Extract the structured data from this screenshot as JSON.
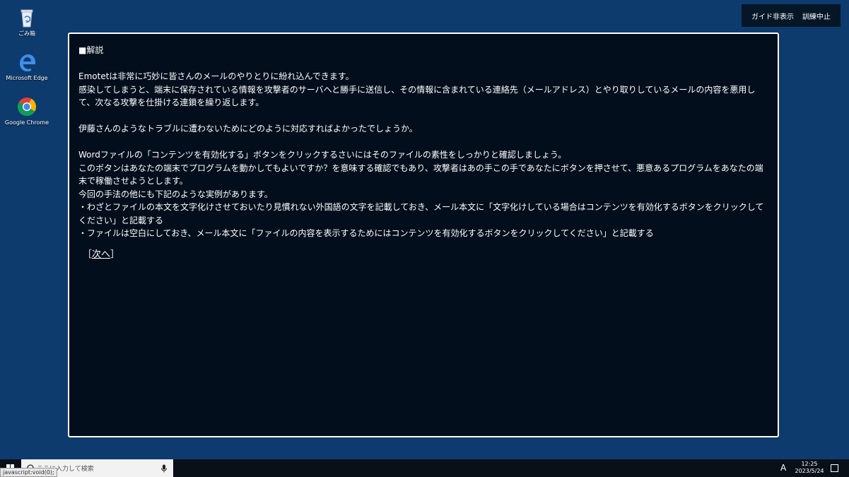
{
  "desktop": {
    "icons": [
      {
        "label": "ごみ箱",
        "icon": "recycle-bin-icon"
      },
      {
        "label": "Microsoft Edge",
        "icon": "edge-icon"
      },
      {
        "label": "Google Chrome",
        "icon": "chrome-icon"
      }
    ]
  },
  "guide_bar": {
    "hide_guide": "ガイド非表示",
    "stop_training": "訓練中止"
  },
  "panel": {
    "heading": "■解説",
    "paragraphs": [
      "Emotetは非常に巧妙に皆さんのメールのやりとりに紛れ込んできます。",
      "感染してしまうと、端末に保存されている情報を攻撃者のサーバへと勝手に送信し、その情報に含まれている連絡先（メールアドレス）とやり取りしているメールの内容を悪用して、次なる攻撃を仕掛ける連鎖を繰り返します。",
      "伊藤さんのようなトラブルに遭わないためにどのように対応すればよかったでしょうか。",
      "Wordファイルの「コンテンツを有効化する」ボタンをクリックするさいにはそのファイルの素性をしっかりと確認しましょう。",
      "このボタンはあなたの端末でプログラムを動かしてもよいですか？を意味する確認でもあり、攻撃者はあの手この手であなたにボタンを押させて、悪意あるプログラムをあなたの端末で稼働させようとします。",
      "今回の手法の他にも下記のような実例があります。",
      "・わざとファイルの本文を文字化けさせておいたり見慣れない外国語の文字を記載しておき、メール本文に「文字化けしている場合はコンテンツを有効化するボタンをクリックしてください」と記載する",
      "・ファイルは空白にしておき、メール本文に「ファイルの内容を表示するためにはコンテンツを有効化するボタンをクリックしてください」と記載する"
    ],
    "next_open": "［",
    "next_link": "次へ",
    "next_close": "］"
  },
  "taskbar": {
    "search_placeholder": "ここに入力して検索",
    "status_tip": "javascript:void(0);",
    "ime": "A",
    "time": "12:25",
    "date": "2023/5/24"
  },
  "colors": {
    "desktop": "#0d3b6e",
    "panel": "#020e1c",
    "taskbar": "#0a1018"
  }
}
